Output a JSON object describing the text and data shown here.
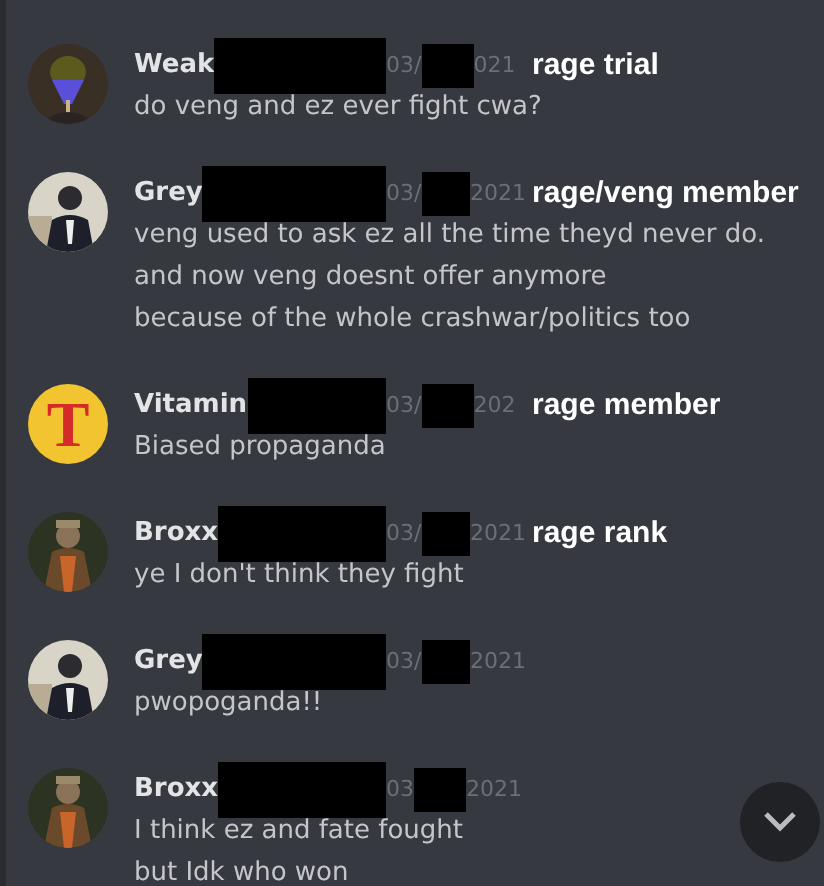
{
  "messages": [
    {
      "author": "Weak",
      "avatar": {
        "kind": "picture"
      },
      "date_start": "03/",
      "date_end": "021",
      "annotation": "rage trial",
      "lines": [
        "do veng and ez ever fight cwa?"
      ]
    },
    {
      "author": "Grey",
      "avatar": {
        "kind": "picture"
      },
      "date_start": "03/",
      "date_end": "2021",
      "annotation": "rage/veng member",
      "lines": [
        "veng used to ask ez all the time theyd never do.",
        "and now veng doesnt offer anymore",
        "because of the whole crashwar/politics too"
      ]
    },
    {
      "author": "Vitamin",
      "avatar": {
        "kind": "letter",
        "letter": "T"
      },
      "date_start": "03/",
      "date_end": "202",
      "annotation": "rage member",
      "lines": [
        "Biased propaganda"
      ]
    },
    {
      "author": "Broxx",
      "avatar": {
        "kind": "picture"
      },
      "date_start": "03/",
      "date_end": "2021",
      "annotation": "rage rank",
      "lines": [
        "ye I don't think they fight"
      ]
    },
    {
      "author": "Grey",
      "avatar": {
        "kind": "picture"
      },
      "date_start": "03/",
      "date_end": "2021",
      "lines": [
        "pwopoganda!!"
      ]
    },
    {
      "author": "Broxx",
      "avatar": {
        "kind": "picture"
      },
      "date_start": "03",
      "date_end": "2021",
      "lines": [
        "I think ez and fate fought",
        "but Idk who won"
      ]
    }
  ]
}
